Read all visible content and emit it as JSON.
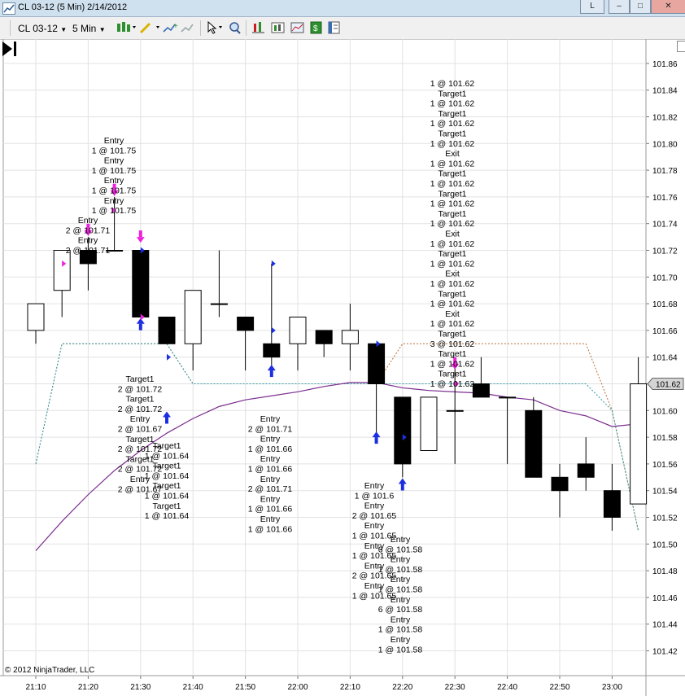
{
  "window": {
    "title": "CL 03-12 (5 Min)  2/14/2012",
    "buttons": [
      "L",
      "–",
      "□",
      "✕"
    ]
  },
  "toolbar": {
    "instrument": "CL 03-12",
    "interval": "5 Min",
    "icons": [
      "bar-style-icon",
      "drawing-tool-icon",
      "add-indicator-icon",
      "remove-indicator-icon",
      "cursor-icon",
      "zoom-icon",
      "strategy-icon",
      "data-box-icon",
      "chart-trader-icon",
      "order-icon",
      "properties-icon"
    ]
  },
  "chart": {
    "copyright": "© 2012 NinjaTrader, LLC",
    "last_price_label": "101.62",
    "colors": {
      "grid": "#e2e2e2",
      "candle_up": "#ffffff",
      "candle_down": "#000000",
      "ma": "#7b2d8e",
      "band_upper": "#b8703a",
      "band_lower": "#2a9aa6",
      "arrow_buy": "#1c2fe0",
      "arrow_sell": "#ee22dd",
      "price_tag": "#d4d4d4"
    }
  },
  "chart_data": {
    "type": "candlestick",
    "x_ticks": [
      "21:10",
      "21:20",
      "21:30",
      "21:40",
      "21:50",
      "22:00",
      "22:10",
      "22:20",
      "22:30",
      "22:40",
      "22:50",
      "23:00"
    ],
    "y_ticks": [
      "101.42",
      "101.44",
      "101.46",
      "101.48",
      "101.50",
      "101.52",
      "101.54",
      "101.56",
      "101.58",
      "101.60",
      "101.62",
      "101.64",
      "101.66",
      "101.68",
      "101.70",
      "101.72",
      "101.74",
      "101.76",
      "101.78",
      "101.80",
      "101.82",
      "101.84",
      "101.86"
    ],
    "ylim": [
      101.41,
      101.875
    ],
    "candles": [
      {
        "t": "21:10",
        "o": 101.66,
        "h": 101.68,
        "l": 101.65,
        "c": 101.68
      },
      {
        "t": "21:15",
        "o": 101.69,
        "h": 101.72,
        "l": 101.67,
        "c": 101.72
      },
      {
        "t": "21:20",
        "o": 101.72,
        "h": 101.73,
        "l": 101.69,
        "c": 101.71
      },
      {
        "t": "21:25",
        "o": 101.72,
        "h": 101.76,
        "l": 101.72,
        "c": 101.72
      },
      {
        "t": "21:30",
        "o": 101.72,
        "h": 101.72,
        "l": 101.67,
        "c": 101.67
      },
      {
        "t": "21:35",
        "o": 101.67,
        "h": 101.67,
        "l": 101.65,
        "c": 101.65
      },
      {
        "t": "21:40",
        "o": 101.65,
        "h": 101.69,
        "l": 101.63,
        "c": 101.69
      },
      {
        "t": "21:45",
        "o": 101.68,
        "h": 101.72,
        "l": 101.67,
        "c": 101.68
      },
      {
        "t": "21:50",
        "o": 101.67,
        "h": 101.67,
        "l": 101.63,
        "c": 101.66
      },
      {
        "t": "21:55",
        "o": 101.65,
        "h": 101.71,
        "l": 101.63,
        "c": 101.64
      },
      {
        "t": "22:00",
        "o": 101.65,
        "h": 101.67,
        "l": 101.63,
        "c": 101.67
      },
      {
        "t": "22:05",
        "o": 101.66,
        "h": 101.66,
        "l": 101.64,
        "c": 101.65
      },
      {
        "t": "22:10",
        "o": 101.65,
        "h": 101.68,
        "l": 101.63,
        "c": 101.66
      },
      {
        "t": "22:15",
        "o": 101.65,
        "h": 101.65,
        "l": 101.58,
        "c": 101.62
      },
      {
        "t": "22:20",
        "o": 101.61,
        "h": 101.61,
        "l": 101.55,
        "c": 101.56
      },
      {
        "t": "22:25",
        "o": 101.57,
        "h": 101.61,
        "l": 101.57,
        "c": 101.61
      },
      {
        "t": "22:30",
        "o": 101.6,
        "h": 101.64,
        "l": 101.56,
        "c": 101.6
      },
      {
        "t": "22:35",
        "o": 101.62,
        "h": 101.64,
        "l": 101.61,
        "c": 101.61
      },
      {
        "t": "22:40",
        "o": 101.61,
        "h": 101.61,
        "l": 101.56,
        "c": 101.61
      },
      {
        "t": "22:45",
        "o": 101.6,
        "h": 101.61,
        "l": 101.55,
        "c": 101.55
      },
      {
        "t": "22:50",
        "o": 101.55,
        "h": 101.56,
        "l": 101.52,
        "c": 101.54
      },
      {
        "t": "22:55",
        "o": 101.56,
        "h": 101.58,
        "l": 101.54,
        "c": 101.55
      },
      {
        "t": "23:00",
        "o": 101.54,
        "h": 101.56,
        "l": 101.51,
        "c": 101.52
      },
      {
        "t": "23:05",
        "o": 101.53,
        "h": 101.64,
        "l": 101.53,
        "c": 101.62
      }
    ],
    "ma": [
      101.495,
      101.517,
      101.537,
      101.555,
      101.57,
      101.583,
      101.594,
      101.603,
      101.608,
      101.611,
      101.614,
      101.618,
      101.621,
      101.621,
      101.617,
      101.615,
      101.614,
      101.613,
      101.61,
      101.608,
      101.6,
      101.596,
      101.588,
      101.59
    ],
    "band_upper": [
      101.56,
      101.65,
      101.65,
      101.65,
      101.65,
      101.65,
      101.62,
      101.62,
      101.62,
      101.62,
      101.62,
      101.62,
      101.62,
      101.62,
      101.65,
      101.65,
      101.65,
      101.65,
      101.65,
      101.65,
      101.65,
      101.65,
      101.6,
      101.51
    ],
    "band_lower": [
      101.56,
      101.65,
      101.65,
      101.65,
      101.65,
      101.65,
      101.62,
      101.62,
      101.62,
      101.62,
      101.62,
      101.62,
      101.62,
      101.62,
      101.62,
      101.62,
      101.62,
      101.62,
      101.62,
      101.62,
      101.62,
      101.62,
      101.6,
      101.51
    ],
    "markers": [
      {
        "type": "sell",
        "i": 2,
        "y": 101.735
      },
      {
        "type": "sell",
        "i": 3,
        "y": 101.765
      },
      {
        "type": "sell",
        "i": 4,
        "y": 101.73
      },
      {
        "type": "buy",
        "i": 4,
        "y": 101.665
      },
      {
        "type": "buy",
        "i": 5,
        "y": 101.595
      },
      {
        "type": "buy",
        "i": 9,
        "y": 101.63
      },
      {
        "type": "buy",
        "i": 13,
        "y": 101.58
      },
      {
        "type": "buy",
        "i": 14,
        "y": 101.545
      },
      {
        "type": "sell",
        "i": 16,
        "y": 101.635
      }
    ],
    "annotations": [
      {
        "x": 140,
        "y": 128,
        "lines": [
          "Entry",
          "1 @ 101.75",
          "Entry",
          "1 @ 101.75",
          "Entry",
          "1 @ 101.75",
          "Entry",
          "1 @ 101.75"
        ]
      },
      {
        "x": 108,
        "y": 226,
        "lines": [
          "Entry",
          "2 @ 101.71",
          "Entry",
          "2 @ 101.71"
        ]
      },
      {
        "x": 172,
        "y": 421,
        "lines": [
          "Target1",
          "2 @ 101.72",
          "Target1",
          "2 @ 101.72",
          "Entry",
          "2 @ 101.67",
          "Target1",
          "2 @ 101.72",
          "Target1",
          "2 @ 101.72",
          "Entry",
          "2 @ 101.67"
        ]
      },
      {
        "x": 205,
        "y": 503,
        "lines": [
          "Target1",
          "1 @ 101.64",
          "Target1",
          "1 @ 101.64",
          "Target1",
          "1 @ 101.64",
          "Target1",
          "1 @ 101.64"
        ]
      },
      {
        "x": 332,
        "y": 470,
        "lines": [
          "Entry",
          "2 @ 101.71",
          "Entry",
          "1 @ 101.66",
          "Entry",
          "1 @ 101.66",
          "Entry",
          "2 @ 101.71",
          "Entry",
          "1 @ 101.66",
          "Entry",
          "1 @ 101.66"
        ]
      },
      {
        "x": 460,
        "y": 552,
        "lines": [
          "Entry",
          "1 @ 101.6",
          "Entry",
          "2 @ 101.65",
          "Entry",
          "1 @ 101.65",
          "Entry",
          "1 @ 101.65",
          "Entry",
          "2 @ 101.65",
          "Entry",
          "1 @ 101.65"
        ]
      },
      {
        "x": 492,
        "y": 618,
        "lines": [
          "Entry",
          "6 @ 101.58",
          "Entry",
          "1 @ 101.58",
          "Entry",
          "1 @ 101.58",
          "Entry",
          "6 @ 101.58",
          "Entry",
          "1 @ 101.58",
          "Entry",
          "1 @ 101.58"
        ]
      },
      {
        "x": 556,
        "y": 58,
        "lines": [
          "1 @ 101.62",
          "Target1",
          "1 @ 101.62",
          "Target1",
          "1 @ 101.62",
          "Target1",
          "1 @ 101.62",
          "Exit",
          "1 @ 101.62",
          "Target1",
          "1 @ 101.62",
          "Target1",
          "1 @ 101.62",
          "Target1",
          "1 @ 101.62",
          "Exit",
          "1 @ 101.62",
          "Target1",
          "1 @ 101.62",
          "Exit",
          "1 @ 101.62",
          "Target1",
          "1 @ 101.62",
          "Exit",
          "1 @ 101.62",
          "Target1",
          "3 @ 101.62",
          "Target1",
          "1 @ 101.62",
          "Target1",
          "1 @ 101.62"
        ]
      }
    ]
  }
}
